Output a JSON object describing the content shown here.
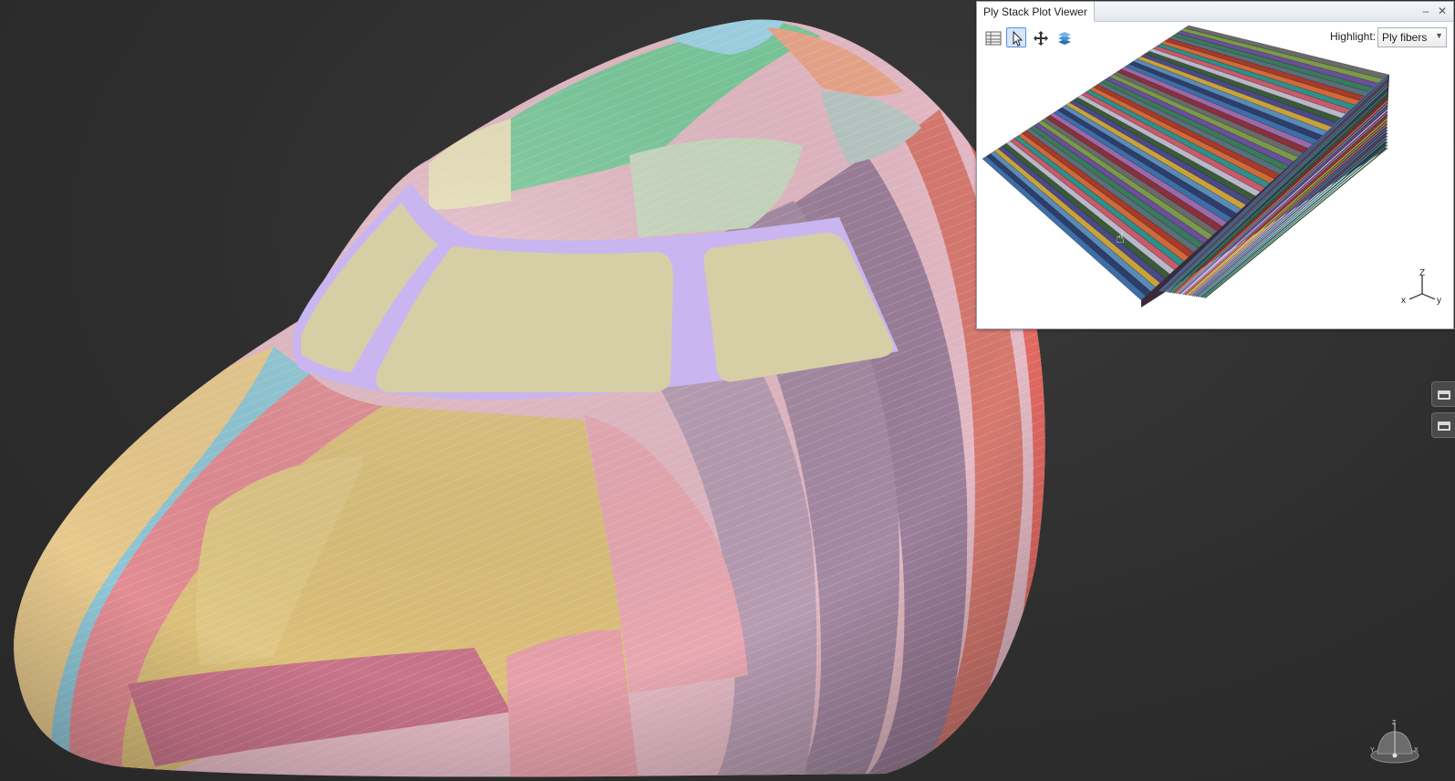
{
  "viewer": {
    "title": "Ply Stack Plot Viewer",
    "toolbar": [
      {
        "name": "ply-table-icon",
        "active": false
      },
      {
        "name": "select-pointer-icon",
        "active": true
      },
      {
        "name": "pan-move-icon",
        "active": false
      },
      {
        "name": "layers-icon",
        "active": false
      }
    ],
    "highlight_label": "Highlight:",
    "highlight_value": "Ply fibers",
    "triad": {
      "z": "Z",
      "x": "x",
      "y": "y"
    }
  },
  "nav_cube": {
    "z": "Z",
    "x": "X",
    "y": "Y"
  },
  "colors": {
    "background": "#2e2e2e",
    "panel_border": "#9aa3ad",
    "active_tool": "#d6e6fa",
    "window_frame": "#c9b6f0",
    "window_glass": "#d6cfa5"
  }
}
